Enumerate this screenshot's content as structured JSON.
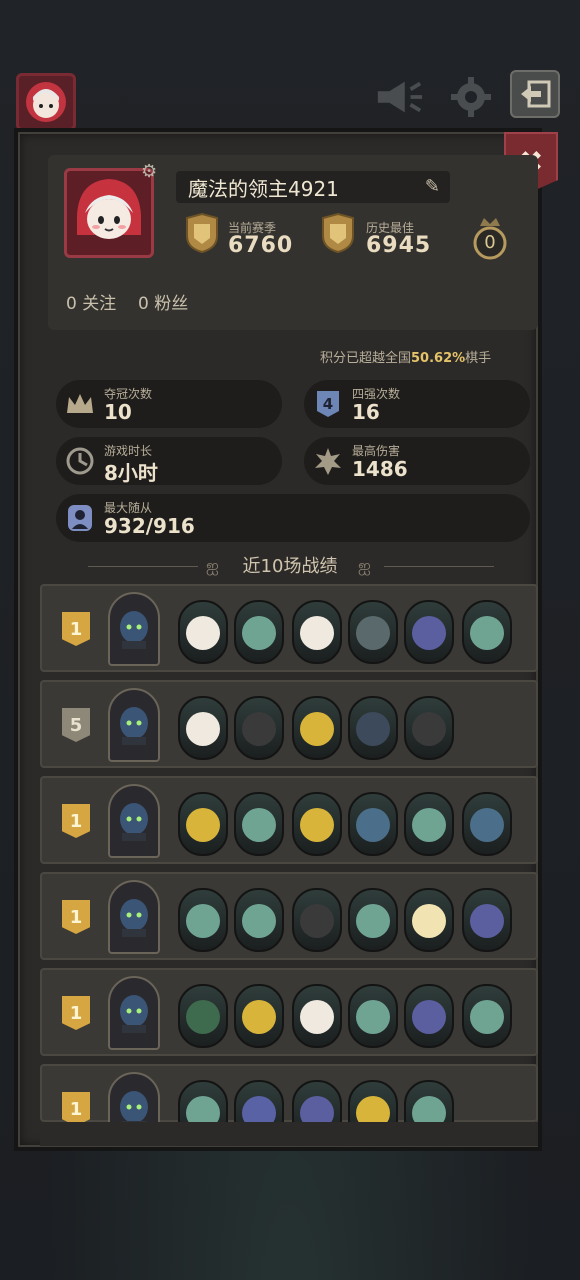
{
  "profile": {
    "name": "魔法的领主4921",
    "current_season_label": "当前赛季",
    "current_season_score": "6760",
    "best_label": "历史最佳",
    "best_score": "6945",
    "crown_count": "0",
    "follow_count": "0",
    "follow_label": "关注",
    "fans_count": "0",
    "fans_label": "粉丝"
  },
  "ranking": {
    "prefix": "积分已超越全国",
    "percent": "50.62%",
    "suffix": "棋手"
  },
  "stats": [
    {
      "label": "夺冠次数",
      "value": "10",
      "icon": "crown-icon"
    },
    {
      "label": "四强次数",
      "value": "16",
      "icon": "top4-icon"
    },
    {
      "label": "游戏时长",
      "value": "8小时",
      "icon": "clock-icon"
    },
    {
      "label": "最高伤害",
      "value": "1486",
      "icon": "damage-icon"
    },
    {
      "label": "最大随从",
      "value": "932/916",
      "icon": "minion-icon"
    }
  ],
  "recent": {
    "title": "近10场战绩",
    "matches": [
      {
        "rank": "1",
        "units": 6
      },
      {
        "rank": "5",
        "units": 5
      },
      {
        "rank": "1",
        "units": 6
      },
      {
        "rank": "1",
        "units": 6
      },
      {
        "rank": "1",
        "units": 6
      },
      {
        "rank": "1",
        "units": 5
      }
    ]
  },
  "colors": {
    "gold": "#d5a642",
    "accent_percent": "#e4c36a",
    "close_red": "#7a2b2f"
  }
}
